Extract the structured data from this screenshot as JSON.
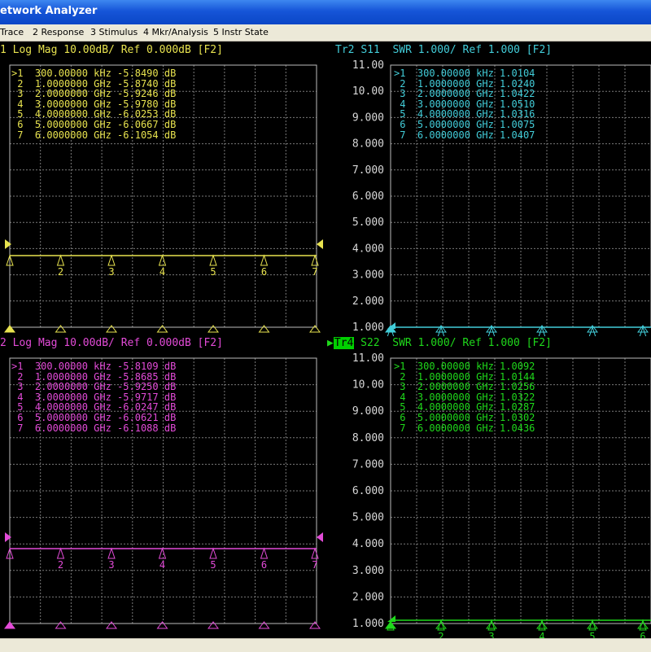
{
  "window": {
    "title": "Network Analyzer",
    "title_shown": "etwork Analyzer"
  },
  "menu": [
    {
      "label": "Trace",
      "shown": "Trace",
      "accel": ""
    },
    {
      "label": "2 Response",
      "accel": ""
    },
    {
      "label": "3 Stimulus",
      "accel": ""
    },
    {
      "label": "4 Mkr/Analysis",
      "accel": ""
    },
    {
      "label": "5 Instr State",
      "accel": ""
    }
  ],
  "colors": {
    "yellow": "#e8e34f",
    "magenta": "#e34bd8",
    "cyan": "#42cdd9",
    "green": "#1fd91b",
    "grid": "#7a7a7a",
    "axis_label": "#d8d8d8"
  },
  "traces": [
    {
      "id": "tr1",
      "header_prefix": "1",
      "header": "Log Mag 10.00dB/ Ref 0.000dB [F2]",
      "color_key": "yellow",
      "active": false,
      "markers": [
        {
          "id": ">1",
          "freq": "300.00000",
          "unit": "kHz",
          "value": "-5.8490",
          "vunit": "dB"
        },
        {
          "id": "2",
          "freq": "1.0000000",
          "unit": "GHz",
          "value": "-5.8740",
          "vunit": "dB"
        },
        {
          "id": "3",
          "freq": "2.0000000",
          "unit": "GHz",
          "value": "-5.9246",
          "vunit": "dB"
        },
        {
          "id": "4",
          "freq": "3.0000000",
          "unit": "GHz",
          "value": "-5.9780",
          "vunit": "dB"
        },
        {
          "id": "5",
          "freq": "4.0000000",
          "unit": "GHz",
          "value": "-6.0253",
          "vunit": "dB"
        },
        {
          "id": "6",
          "freq": "5.0000000",
          "unit": "GHz",
          "value": "-6.0667",
          "vunit": "dB"
        },
        {
          "id": "7",
          "freq": "6.0000000",
          "unit": "GHz",
          "value": "-6.1054",
          "vunit": "dB"
        }
      ]
    },
    {
      "id": "tr2",
      "header_prefix": "Tr2",
      "header": "S11  SWR 1.000/ Ref 1.000 [F2]",
      "color_key": "cyan",
      "active": false,
      "y_labels": [
        "11.00",
        "10.00",
        "9.000",
        "8.000",
        "7.000",
        "6.000",
        "5.000",
        "4.000",
        "3.000",
        "2.000",
        "1.000"
      ],
      "markers": [
        {
          "id": ">1",
          "freq": "300.00000",
          "unit": "kHz",
          "value": "1.0104",
          "vunit": ""
        },
        {
          "id": "2",
          "freq": "1.0000000",
          "unit": "GHz",
          "value": "1.0240",
          "vunit": ""
        },
        {
          "id": "3",
          "freq": "2.0000000",
          "unit": "GHz",
          "value": "1.0422",
          "vunit": ""
        },
        {
          "id": "4",
          "freq": "3.0000000",
          "unit": "GHz",
          "value": "1.0510",
          "vunit": ""
        },
        {
          "id": "5",
          "freq": "4.0000000",
          "unit": "GHz",
          "value": "1.0316",
          "vunit": ""
        },
        {
          "id": "6",
          "freq": "5.0000000",
          "unit": "GHz",
          "value": "1.0075",
          "vunit": ""
        },
        {
          "id": "7",
          "freq": "6.0000000",
          "unit": "GHz",
          "value": "1.0407",
          "vunit": ""
        }
      ]
    },
    {
      "id": "tr3",
      "header_prefix": "2",
      "header": "Log Mag 10.00dB/ Ref 0.000dB [F2]",
      "color_key": "magenta",
      "active": false,
      "markers": [
        {
          "id": ">1",
          "freq": "300.00000",
          "unit": "kHz",
          "value": "-5.8109",
          "vunit": "dB"
        },
        {
          "id": "2",
          "freq": "1.0000000",
          "unit": "GHz",
          "value": "-5.8685",
          "vunit": "dB"
        },
        {
          "id": "3",
          "freq": "2.0000000",
          "unit": "GHz",
          "value": "-5.9250",
          "vunit": "dB"
        },
        {
          "id": "4",
          "freq": "3.0000000",
          "unit": "GHz",
          "value": "-5.9717",
          "vunit": "dB"
        },
        {
          "id": "5",
          "freq": "4.0000000",
          "unit": "GHz",
          "value": "-6.0247",
          "vunit": "dB"
        },
        {
          "id": "6",
          "freq": "5.0000000",
          "unit": "GHz",
          "value": "-6.0621",
          "vunit": "dB"
        },
        {
          "id": "7",
          "freq": "6.0000000",
          "unit": "GHz",
          "value": "-6.1088",
          "vunit": "dB"
        }
      ]
    },
    {
      "id": "tr4",
      "header_prefix": "Tr4",
      "header": "S22  SWR 1.000/ Ref 1.000 [F2]",
      "color_key": "green",
      "active": true,
      "y_labels": [
        "11.00",
        "10.00",
        "9.000",
        "8.000",
        "7.000",
        "6.000",
        "5.000",
        "4.000",
        "3.000",
        "2.000",
        "1.000"
      ],
      "markers": [
        {
          "id": ">1",
          "freq": "300.00000",
          "unit": "kHz",
          "value": "1.0092",
          "vunit": ""
        },
        {
          "id": "2",
          "freq": "1.0000000",
          "unit": "GHz",
          "value": "1.0144",
          "vunit": ""
        },
        {
          "id": "3",
          "freq": "2.0000000",
          "unit": "GHz",
          "value": "1.0256",
          "vunit": ""
        },
        {
          "id": "4",
          "freq": "3.0000000",
          "unit": "GHz",
          "value": "1.0322",
          "vunit": ""
        },
        {
          "id": "5",
          "freq": "4.0000000",
          "unit": "GHz",
          "value": "1.0287",
          "vunit": ""
        },
        {
          "id": "6",
          "freq": "5.0000000",
          "unit": "GHz",
          "value": "1.0302",
          "vunit": ""
        },
        {
          "id": "7",
          "freq": "6.0000000",
          "unit": "GHz",
          "value": "1.0436",
          "vunit": ""
        }
      ]
    }
  ]
}
